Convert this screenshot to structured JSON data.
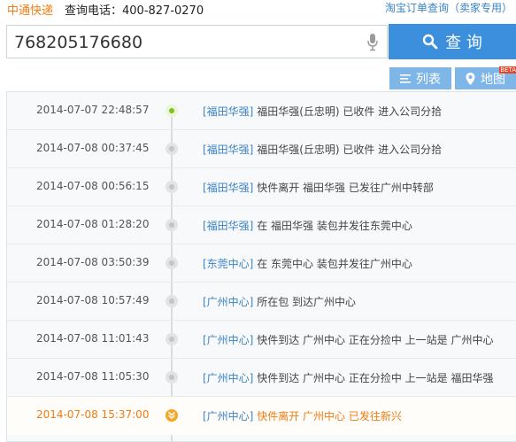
{
  "header": {
    "brand": "中通快递",
    "phone": "查询电话：400-827-0270",
    "top_link": "淘宝订单查询（卖家专用）"
  },
  "search": {
    "value": "768205176680",
    "button_label": "查 询"
  },
  "tabs": [
    {
      "label": "列表",
      "icon": "list-icon",
      "active": true
    },
    {
      "label": "地图",
      "icon": "map-pin-icon",
      "badge": "BETA"
    }
  ],
  "colors": {
    "accent": "#3c8fdc",
    "brand": "#f07c14",
    "tab": "#7fb6e8",
    "status_ok": "#7fc21a",
    "current": "#f6a623"
  },
  "events": [
    {
      "time": "2014-07-07 22:48:57",
      "loc": "[福田华强]",
      "text": " 福田华强(丘忠明) 已收件 进入公司分拾"
    },
    {
      "time": "2014-07-08 00:37:45",
      "loc": "[福田华强]",
      "text": " 福田华强(丘忠明) 已收件 进入公司分拾"
    },
    {
      "time": "2014-07-08 00:56:15",
      "loc": "[福田华强]",
      "text": " 快件离开 福田华强 已发往广州中转部"
    },
    {
      "time": "2014-07-08 01:28:20",
      "loc": "[福田华强]",
      "text": " 在 福田华强 装包并发往东莞中心"
    },
    {
      "time": "2014-07-08 03:50:39",
      "loc": "[东莞中心]",
      "text": " 在 东莞中心 装包并发往广州中心"
    },
    {
      "time": "2014-07-08 10:57:49",
      "loc": "[广州中心]",
      "text": " 所在包 到达广州中心"
    },
    {
      "time": "2014-07-08 11:01:43",
      "loc": "[广州中心]",
      "text": " 快件到达 广州中心 正在分捡中 上一站是 广州中心"
    },
    {
      "time": "2014-07-08 11:05:30",
      "loc": "[广州中心]",
      "text": " 快件到达 广州中心 正在分捡中 上一站是 福田华强"
    },
    {
      "time": "2014-07-08 15:37:00",
      "loc": "[广州中心]",
      "text": " 快件离开 广州中心 已发往新兴"
    }
  ]
}
